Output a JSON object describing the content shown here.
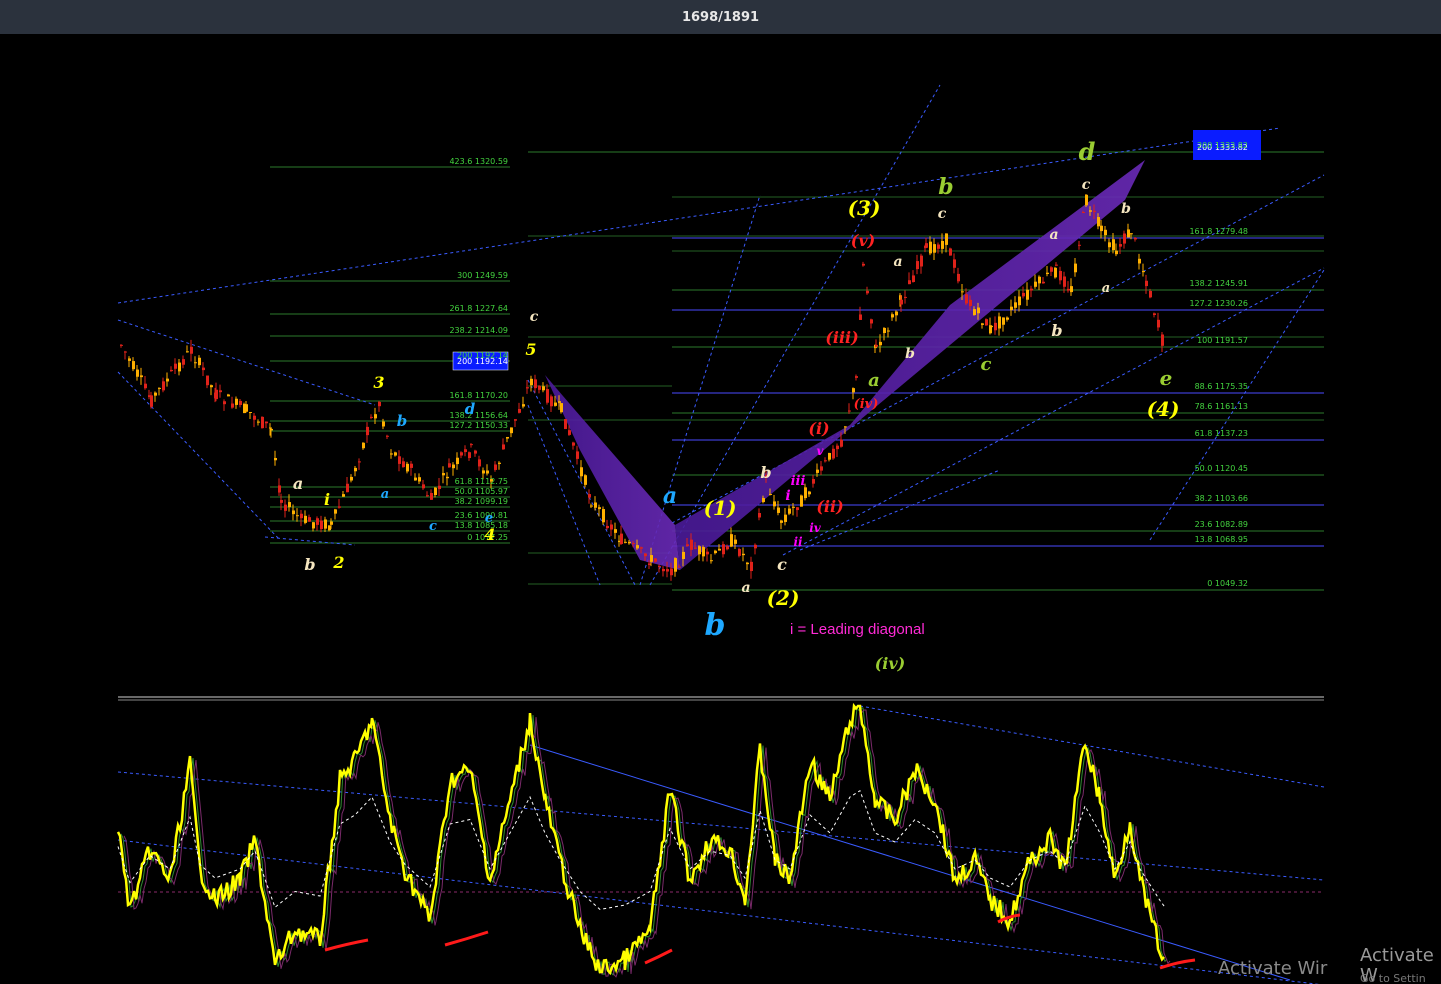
{
  "header": {
    "counter": "1698/1891"
  },
  "note": "i = Leading diagonal",
  "watermark": {
    "line1": "Activate Wir",
    "line2": "Activate W",
    "line3": "Go to Settin"
  },
  "colors": {
    "bg": "#000000",
    "up": "#ffb000",
    "down": "#e0221a",
    "fib_line": "#2d7a2d",
    "fib_line_right": "#4a4aff",
    "channel": "#5a2aa8",
    "highlight_box": "#0a1cff",
    "osc_main": "#ffff00"
  },
  "left_fib": [
    {
      "label": "423.6 1320.59"
    },
    {
      "label": "300 1249.59"
    },
    {
      "label": "261.8 1227.64"
    },
    {
      "label": "238.2 1214.09"
    },
    {
      "label": "200 1192.14"
    },
    {
      "label": "161.8 1170.20"
    },
    {
      "label": "138.2 1156.64"
    },
    {
      "label": "127.2 1150.33"
    },
    {
      "label": "61.8 1112.75"
    },
    {
      "label": "50.0 1105.97"
    },
    {
      "label": "38.2 1099.19"
    },
    {
      "label": "23.6 1090.81"
    },
    {
      "label": "13.8 1085.18"
    },
    {
      "label": "0 1077.25"
    }
  ],
  "right_fib": [
    {
      "label": "200 1333.82"
    },
    {
      "label": "161.8 1279.48"
    },
    {
      "label": "138.2 1245.91"
    },
    {
      "label": "127.2 1230.26"
    },
    {
      "label": "100 1191.57"
    },
    {
      "label": "88.6 1175.35"
    },
    {
      "label": "78.6 1161.13"
    },
    {
      "label": "61.8 1137.23"
    },
    {
      "label": "50.0 1120.45"
    },
    {
      "label": "38.2 1103.66"
    },
    {
      "label": "23.6 1082.89"
    },
    {
      "label": "13.8 1068.95"
    },
    {
      "label": "0 1049.32"
    }
  ],
  "wave_labels": [
    {
      "text": "a",
      "color": "#f5e6c0"
    },
    {
      "text": "b",
      "color": "#f5e6c0"
    },
    {
      "text": "i",
      "color": "#ffff00"
    },
    {
      "text": "2",
      "color": "#ffff00"
    },
    {
      "text": "3",
      "color": "#ffff00"
    },
    {
      "text": "b",
      "color": "#1ea8ff"
    },
    {
      "text": "a",
      "color": "#1ea8ff"
    },
    {
      "text": "c",
      "color": "#1ea8ff"
    },
    {
      "text": "d",
      "color": "#1ea8ff"
    },
    {
      "text": "e",
      "color": "#1ea8ff"
    },
    {
      "text": "4",
      "color": "#ffff00"
    },
    {
      "text": "5",
      "color": "#ffff00"
    },
    {
      "text": "c",
      "color": "#f5e6c0"
    },
    {
      "text": "a",
      "color": "#1ea8ff"
    },
    {
      "text": "b",
      "color": "#1ea8ff"
    },
    {
      "text": "(1)",
      "color": "#ffff00"
    },
    {
      "text": "a",
      "color": "#f5e6c0"
    },
    {
      "text": "b",
      "color": "#f5e6c0"
    },
    {
      "text": "c",
      "color": "#f5e6c0"
    },
    {
      "text": "(2)",
      "color": "#ffff00"
    },
    {
      "text": "i",
      "color": "#ff00ff"
    },
    {
      "text": "ii",
      "color": "#ff00ff"
    },
    {
      "text": "iii",
      "color": "#ff00ff"
    },
    {
      "text": "iv",
      "color": "#ff00ff"
    },
    {
      "text": "v",
      "color": "#ff00ff"
    },
    {
      "text": "(i)",
      "color": "#ff2222"
    },
    {
      "text": "(ii)",
      "color": "#ff2222"
    },
    {
      "text": "(iii)",
      "color": "#ff2222"
    },
    {
      "text": "(iv)",
      "color": "#ff2222"
    },
    {
      "text": "(v)",
      "color": "#ff2222"
    },
    {
      "text": "(3)",
      "color": "#ffff00"
    },
    {
      "text": "a",
      "color": "#f5e6c0"
    },
    {
      "text": "b",
      "color": "#f5e6c0"
    },
    {
      "text": "c",
      "color": "#f5e6c0"
    },
    {
      "text": "a",
      "color": "#9acd32"
    },
    {
      "text": "b",
      "color": "#9acd32"
    },
    {
      "text": "c",
      "color": "#9acd32"
    },
    {
      "text": "a",
      "color": "#f5e6c0"
    },
    {
      "text": "b",
      "color": "#f5e6c0"
    },
    {
      "text": "a",
      "color": "#f5e6c0"
    },
    {
      "text": "c",
      "color": "#f5e6c0"
    },
    {
      "text": "b",
      "color": "#f5e6c0"
    },
    {
      "text": "d",
      "color": "#9acd32"
    },
    {
      "text": "e",
      "color": "#9acd32"
    },
    {
      "text": "(4)",
      "color": "#ffff00"
    },
    {
      "text": "(iv)",
      "color": "#9acd32"
    }
  ],
  "chart_data": {
    "type": "candlestick",
    "title": "",
    "xlabel": "",
    "ylabel": "",
    "price_range": [
      1049.32,
      1333.82
    ],
    "oscillator": {
      "type": "line",
      "series_color": "#ffff00"
    }
  }
}
